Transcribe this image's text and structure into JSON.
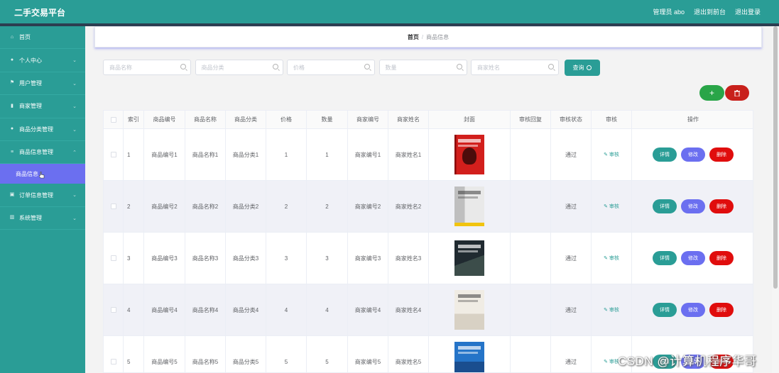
{
  "app": {
    "title": "二手交易平台",
    "admin_label": "管理员 abo",
    "front_link": "退出到前台",
    "logout_link": "退出登录"
  },
  "sidebar": {
    "items": [
      {
        "label": "首页",
        "icon": "home-icon"
      },
      {
        "label": "个人中心",
        "icon": "user-icon"
      },
      {
        "label": "用户管理",
        "icon": "flag-icon"
      },
      {
        "label": "商家管理",
        "icon": "chart-icon"
      },
      {
        "label": "商品分类管理",
        "icon": "pin-icon"
      },
      {
        "label": "商品信息管理",
        "icon": "list-icon"
      },
      {
        "label": "订单信息管理",
        "icon": "box-icon"
      },
      {
        "label": "系统管理",
        "icon": "bars-icon"
      }
    ],
    "sub_item": "商品信息"
  },
  "breadcrumb": {
    "home": "首页",
    "separator": "/",
    "current": "商品信息"
  },
  "search": {
    "name_placeholder": "商品名称",
    "category_placeholder": "商品分类",
    "price_placeholder": "价格",
    "quantity_placeholder": "数量",
    "merchant_placeholder": "商家姓名",
    "query_button": "查询"
  },
  "actions": {
    "add": "+"
  },
  "table": {
    "headers": {
      "index": "索引",
      "code": "商品编号",
      "name": "商品名称",
      "category": "商品分类",
      "price": "价格",
      "quantity": "数量",
      "merchant_code": "商家编号",
      "merchant_name": "商家姓名",
      "cover": "封面",
      "review_reply": "审核回复",
      "review_status": "审核状态",
      "review": "审核",
      "operation": "操作"
    },
    "rows": [
      {
        "index": "1",
        "code": "商品编号1",
        "name": "商品名称1",
        "category": "商品分类1",
        "price": "1",
        "quantity": "1",
        "merchant_code": "商家编号1",
        "merchant_name": "商家姓名1",
        "review_reply": "",
        "review_status": "通过",
        "review_link": "审核",
        "cover_style": "red"
      },
      {
        "index": "2",
        "code": "商品编号2",
        "name": "商品名称2",
        "category": "商品分类2",
        "price": "2",
        "quantity": "2",
        "merchant_code": "商家编号2",
        "merchant_name": "商家姓名2",
        "review_reply": "",
        "review_status": "通过",
        "review_link": "审核",
        "cover_style": "gray"
      },
      {
        "index": "3",
        "code": "商品编号3",
        "name": "商品名称3",
        "category": "商品分类3",
        "price": "3",
        "quantity": "3",
        "merchant_code": "商家编号3",
        "merchant_name": "商家姓名3",
        "review_reply": "",
        "review_status": "通过",
        "review_link": "审核",
        "cover_style": "dark"
      },
      {
        "index": "4",
        "code": "商品编号4",
        "name": "商品名称4",
        "category": "商品分类4",
        "price": "4",
        "quantity": "4",
        "merchant_code": "商家编号4",
        "merchant_name": "商家姓名4",
        "review_reply": "",
        "review_status": "通过",
        "review_link": "审核",
        "cover_style": "light"
      },
      {
        "index": "5",
        "code": "商品编号5",
        "name": "商品名称5",
        "category": "商品分类5",
        "price": "5",
        "quantity": "5",
        "merchant_code": "商家编号5",
        "merchant_name": "商家姓名5",
        "review_reply": "",
        "review_status": "通过",
        "review_link": "审核",
        "cover_style": "blue"
      }
    ],
    "buttons": {
      "detail": "详情",
      "edit": "修改",
      "delete": "删除"
    }
  },
  "watermark": "CSDN @计算机程序华哥",
  "colors": {
    "primary": "#2a9d96",
    "accent": "#6b6ff0",
    "danger": "#e00d0d",
    "success": "#29a548",
    "dark_red": "#c8201b"
  }
}
